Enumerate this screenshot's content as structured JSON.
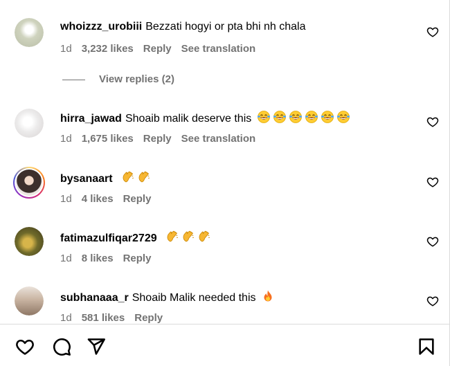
{
  "comments": [
    {
      "username": "whoizzz_urobiii",
      "text": "Bezzati hogyi or pta bhi nh chala",
      "time": "1d",
      "likes": "3,232 likes",
      "reply": "Reply",
      "translation": "See translation",
      "emoji": [],
      "avatar_color": "#d9dccb"
    },
    {
      "username": "hirra_jawad",
      "text": "Shoaib malik deserve this",
      "time": "1d",
      "likes": "1,675 likes",
      "reply": "Reply",
      "translation": "See translation",
      "emoji": [
        "laughing-tears",
        "laughing-tears",
        "laughing-tears",
        "laughing-tears",
        "laughing-tears",
        "laughing-tears"
      ],
      "avatar_color": "#e8e4e4"
    },
    {
      "username": "bysanaart",
      "text": "",
      "time": "1d",
      "likes": "4 likes",
      "reply": "Reply",
      "emoji": [
        "clapping-hands",
        "clapping-hands"
      ],
      "avatar_color": "#5a4b46"
    },
    {
      "username": "fatimazulfiqar2729",
      "text": "",
      "time": "1d",
      "likes": "8 likes",
      "reply": "Reply",
      "emoji": [
        "clapping-hands",
        "clapping-hands",
        "clapping-hands"
      ],
      "avatar_color": "#8a7a3a"
    },
    {
      "username": "subhanaaa_r",
      "text": "Shoaib Malik needed this",
      "time": "1d",
      "likes": "581 likes",
      "reply": "Reply",
      "emoji": [
        "fire"
      ],
      "avatar_color": "#c8b7a6"
    }
  ],
  "view_replies": "View replies (2)",
  "action_bar": {
    "like_icon": "heart-icon",
    "comment_icon": "comment-icon",
    "share_icon": "share-icon",
    "save_icon": "bookmark-icon"
  },
  "colors": {
    "secondary_text": "#737373",
    "divider": "#dbdbdb",
    "emoji_yellow": "#ffcc33"
  }
}
